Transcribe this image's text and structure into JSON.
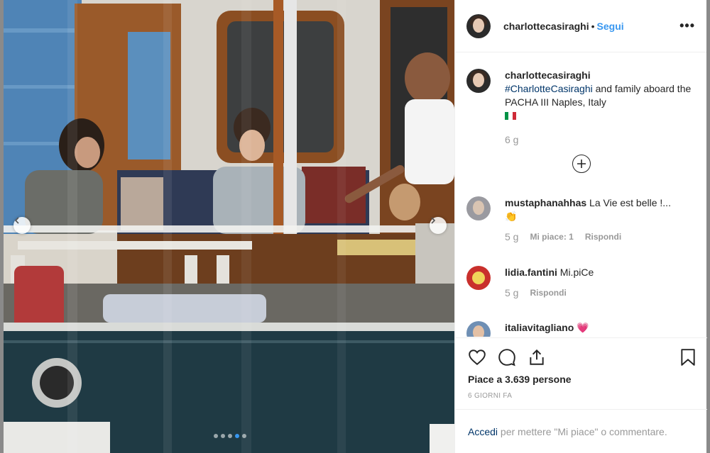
{
  "post": {
    "username": "charlottecasiraghi",
    "separator": "•",
    "follow_label": "Segui",
    "more_label": "•••"
  },
  "caption": {
    "username": "charlottecasiraghi",
    "hashtag": "#CharlotteCasiraghi",
    "text": " and family aboard the PACHA III Naples, Italy",
    "flag": "italy-flag",
    "time": "6 g"
  },
  "comments": [
    {
      "username": "mustaphanahhas",
      "text": "La Vie est belle !...",
      "emoji": "clapping-hands-emoji",
      "time": "5 g",
      "likes": "Mi piace: 1",
      "reply": "Rispondi"
    },
    {
      "username": "lidia.fantini",
      "text": "Mi.piCe",
      "time": "5 g",
      "reply": "Rispondi"
    },
    {
      "username": "italiavitagliano",
      "text": "💗"
    }
  ],
  "actions": {
    "likes_text": "Piace a 3.639 persone",
    "time_ago": "6 GIORNI FA",
    "icons": [
      "heart-icon",
      "comment-icon",
      "share-icon",
      "bookmark-icon"
    ]
  },
  "footer": {
    "login_label": "Accedi",
    "rest": " per mettere \"Mi piace\" o commentare."
  },
  "carousel": {
    "total": 5,
    "active": 4
  },
  "colors": {
    "accent": "#3897f0",
    "link_dark": "#003569",
    "muted": "#999999",
    "text": "#262626"
  }
}
